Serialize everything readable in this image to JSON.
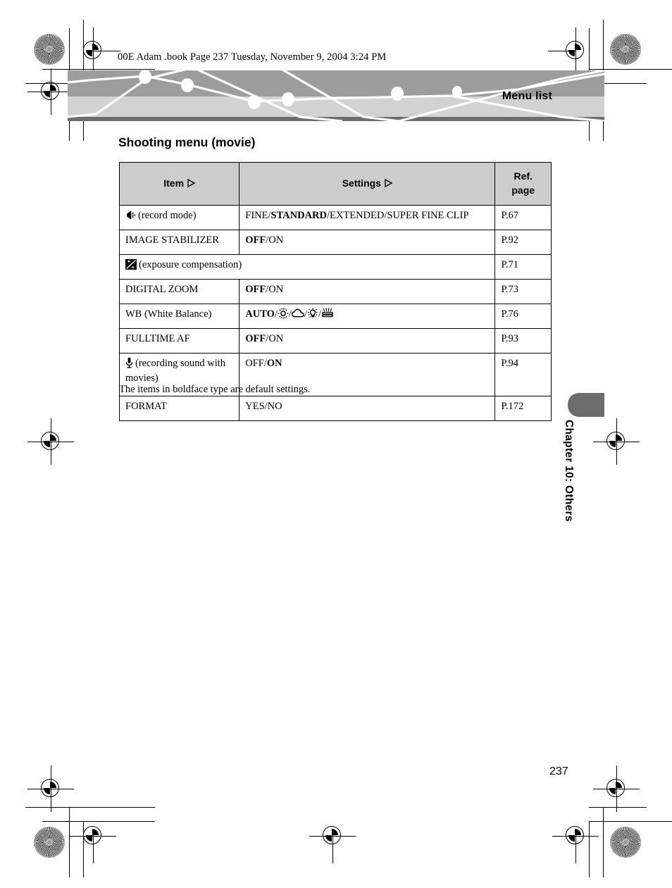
{
  "print_marks": {
    "book_info": "00E Adam .book  Page 237  Tuesday, November 9, 2004  3:24 PM",
    "registration_icon": "registration-starburst",
    "crosshair_icon": "registration-crosshair"
  },
  "banner": {
    "title": "Menu list",
    "band_top_color": "#9d9d9d",
    "band_bottom_color": "#d2d2d2",
    "rule_color": "#6d6d6d",
    "line_color": "#ffffff"
  },
  "content": {
    "section_title": "Shooting menu (movie)",
    "note": "The items in boldface type are default settings."
  },
  "table": {
    "headers": {
      "item": "Item",
      "settings": "Settings",
      "ref": "Ref.",
      "ref2": "page"
    },
    "header_bg": "#cccccc",
    "rows": [
      {
        "icon": "record-mode-icon",
        "item": "(record mode)",
        "settings_parts": [
          {
            "text": "FINE/",
            "bold": false
          },
          {
            "text": "STANDARD",
            "bold": true
          },
          {
            "text": "/EXTENDED/SUPER FINE CLIP",
            "bold": false
          }
        ],
        "settings_plain": "FINE/STANDARD/EXTENDED/SUPER FINE CLIP",
        "ref": "P.67"
      },
      {
        "icon": "",
        "item": "IMAGE STABILIZER",
        "settings_parts": [
          {
            "text": "OFF",
            "bold": true
          },
          {
            "text": "/ON",
            "bold": false
          }
        ],
        "settings_plain": "OFF/ON",
        "ref": "P.92"
      },
      {
        "icon": "exposure-compensation-icon",
        "item": "(exposure compensation)",
        "span_item_settings": true,
        "settings_parts": [],
        "settings_plain": "",
        "ref": "P.71"
      },
      {
        "icon": "",
        "item": "DIGITAL ZOOM",
        "settings_parts": [
          {
            "text": "OFF",
            "bold": true
          },
          {
            "text": "/ON",
            "bold": false
          }
        ],
        "settings_plain": "OFF/ON",
        "ref": "P.73"
      },
      {
        "icon": "",
        "item": "WB (White Balance)",
        "settings_parts": [
          {
            "text": "AUTO",
            "bold": true
          }
        ],
        "settings_icons": [
          "daylight-sun-icon",
          "overcast-cloud-icon",
          "incandescent-bulb-icon",
          "fluorescent-lamp-icon"
        ],
        "settings_plain": "AUTO/sun/cloud/bulb/fluorescent",
        "ref": "P.76"
      },
      {
        "icon": "",
        "item": "FULLTIME AF",
        "settings_parts": [
          {
            "text": "OFF",
            "bold": true
          },
          {
            "text": "/ON",
            "bold": false
          }
        ],
        "settings_plain": "OFF/ON",
        "ref": "P.93"
      },
      {
        "icon": "microphone-icon",
        "item": "(recording sound with movies)",
        "settings_parts": [
          {
            "text": "OFF/",
            "bold": false
          },
          {
            "text": "ON",
            "bold": true
          }
        ],
        "settings_plain": "OFF/ON",
        "ref": "P.94"
      },
      {
        "icon": "",
        "item": "FORMAT",
        "settings_parts": [
          {
            "text": "YES/NO",
            "bold": false
          }
        ],
        "settings_plain": "YES/NO",
        "ref": "P.172"
      }
    ]
  },
  "sidebar": {
    "chapter_label": "Chapter 10: Others",
    "tab_color": "#6d6d6d"
  },
  "footer": {
    "page_number": "237"
  }
}
